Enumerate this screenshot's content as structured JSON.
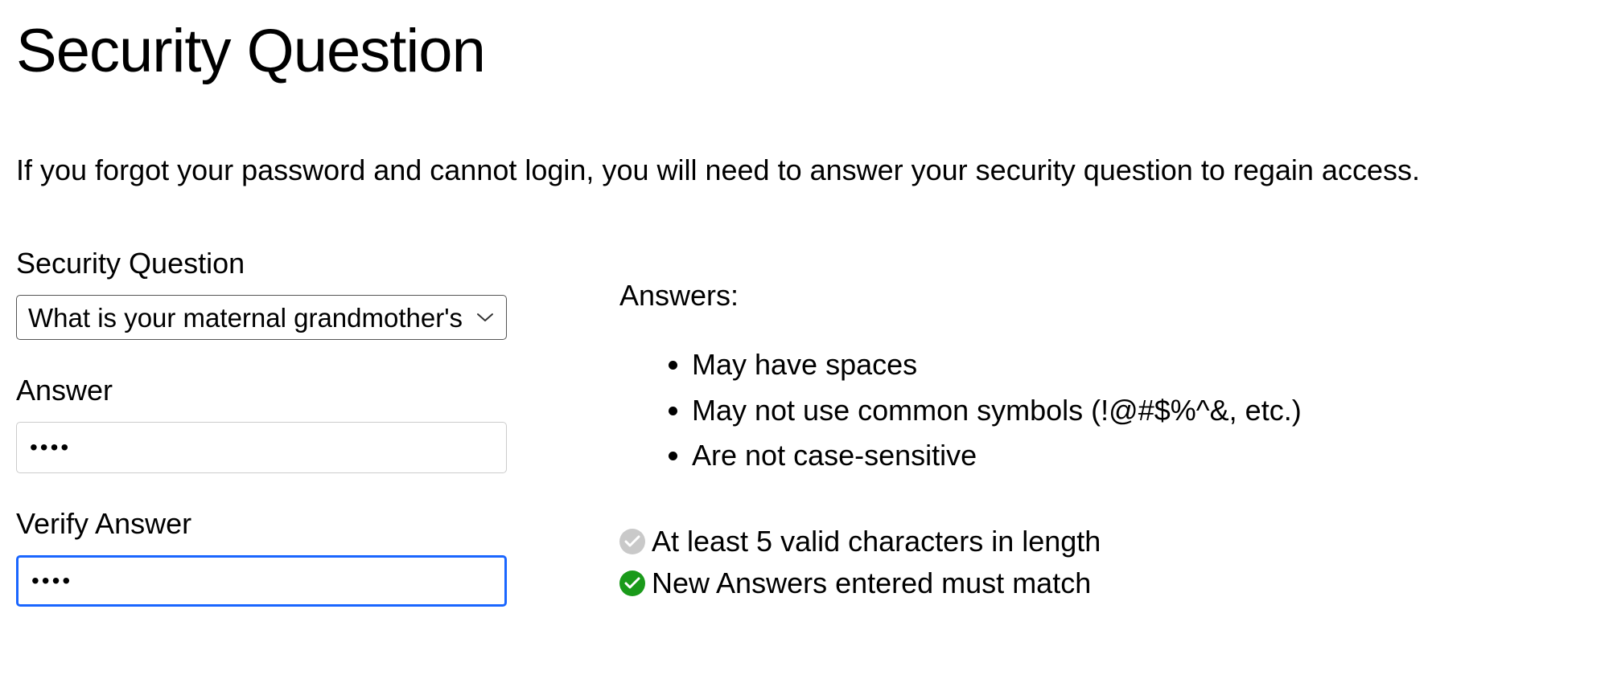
{
  "title": "Security Question",
  "description": "If you forgot your password and cannot login, you will need to answer your security question to regain access.",
  "fields": {
    "question": {
      "label": "Security Question",
      "selected": "What is your maternal grandmother's maiden name?"
    },
    "answer": {
      "label": "Answer",
      "value": "••••"
    },
    "verify": {
      "label": "Verify Answer",
      "value": "••••"
    }
  },
  "rules": {
    "heading": "Answers:",
    "items": [
      "May have spaces",
      "May not use common symbols (!@#$%^&, etc.)",
      "Are not case-sensitive"
    ]
  },
  "checks": {
    "length": {
      "text": "At least 5 valid characters in length",
      "passed": false
    },
    "match": {
      "text": "New Answers entered must match",
      "passed": true
    }
  }
}
